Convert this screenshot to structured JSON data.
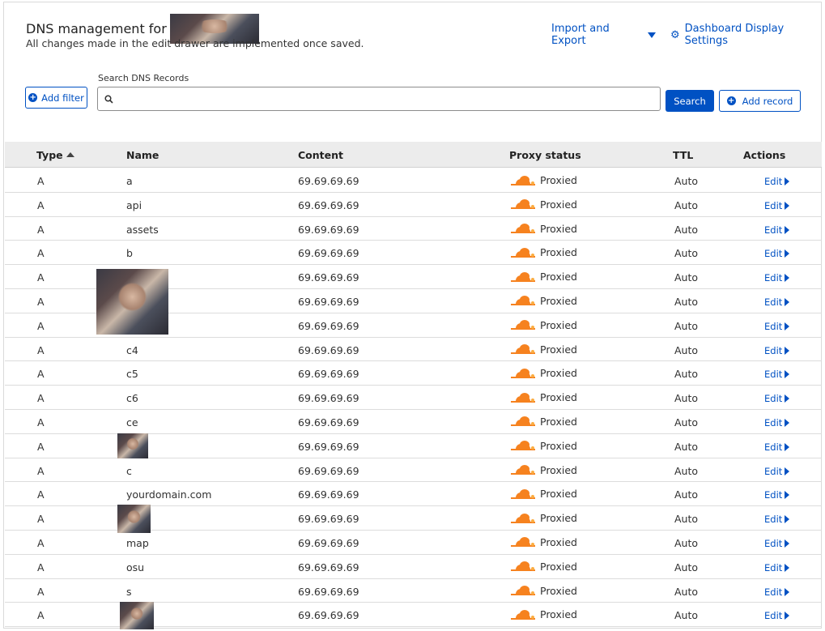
{
  "header": {
    "title": "DNS management for",
    "subtitle": "All changes made in the edit drawer are implemented once saved.",
    "import_export_label": "Import and Export",
    "display_settings_label": "Dashboard Display Settings"
  },
  "toolbar": {
    "add_filter_label": "Add filter",
    "search_label": "Search DNS Records",
    "search_value": "",
    "search_button_label": "Search",
    "add_record_label": "Add record"
  },
  "table": {
    "columns": [
      "Type",
      "Name",
      "Content",
      "Proxy status",
      "TTL",
      "Actions"
    ],
    "rows": [
      {
        "type": "A",
        "name": "a",
        "content": "69.69.69.69",
        "proxy": "Proxied",
        "ttl": "Auto",
        "action": "Edit"
      },
      {
        "type": "A",
        "name": "api",
        "content": "69.69.69.69",
        "proxy": "Proxied",
        "ttl": "Auto",
        "action": "Edit"
      },
      {
        "type": "A",
        "name": "assets",
        "content": "69.69.69.69",
        "proxy": "Proxied",
        "ttl": "Auto",
        "action": "Edit"
      },
      {
        "type": "A",
        "name": "b",
        "content": "69.69.69.69",
        "proxy": "Proxied",
        "ttl": "Auto",
        "action": "Edit"
      },
      {
        "type": "A",
        "name": "",
        "content": "69.69.69.69",
        "proxy": "Proxied",
        "ttl": "Auto",
        "action": "Edit"
      },
      {
        "type": "A",
        "name": "",
        "content": "69.69.69.69",
        "proxy": "Proxied",
        "ttl": "Auto",
        "action": "Edit"
      },
      {
        "type": "A",
        "name": "",
        "content": "69.69.69.69",
        "proxy": "Proxied",
        "ttl": "Auto",
        "action": "Edit"
      },
      {
        "type": "A",
        "name": "c4",
        "content": "69.69.69.69",
        "proxy": "Proxied",
        "ttl": "Auto",
        "action": "Edit"
      },
      {
        "type": "A",
        "name": "c5",
        "content": "69.69.69.69",
        "proxy": "Proxied",
        "ttl": "Auto",
        "action": "Edit"
      },
      {
        "type": "A",
        "name": "c6",
        "content": "69.69.69.69",
        "proxy": "Proxied",
        "ttl": "Auto",
        "action": "Edit"
      },
      {
        "type": "A",
        "name": "ce",
        "content": "69.69.69.69",
        "proxy": "Proxied",
        "ttl": "Auto",
        "action": "Edit"
      },
      {
        "type": "A",
        "name": "",
        "content": "69.69.69.69",
        "proxy": "Proxied",
        "ttl": "Auto",
        "action": "Edit"
      },
      {
        "type": "A",
        "name": "c",
        "content": "69.69.69.69",
        "proxy": "Proxied",
        "ttl": "Auto",
        "action": "Edit"
      },
      {
        "type": "A",
        "name": "yourdomain.com",
        "content": "69.69.69.69",
        "proxy": "Proxied",
        "ttl": "Auto",
        "action": "Edit"
      },
      {
        "type": "A",
        "name": "",
        "content": "69.69.69.69",
        "proxy": "Proxied",
        "ttl": "Auto",
        "action": "Edit"
      },
      {
        "type": "A",
        "name": "map",
        "content": "69.69.69.69",
        "proxy": "Proxied",
        "ttl": "Auto",
        "action": "Edit"
      },
      {
        "type": "A",
        "name": "osu",
        "content": "69.69.69.69",
        "proxy": "Proxied",
        "ttl": "Auto",
        "action": "Edit"
      },
      {
        "type": "A",
        "name": "s",
        "content": "69.69.69.69",
        "proxy": "Proxied",
        "ttl": "Auto",
        "action": "Edit"
      },
      {
        "type": "A",
        "name": "",
        "content": "69.69.69.69",
        "proxy": "Proxied",
        "ttl": "Auto",
        "action": "Edit"
      }
    ]
  },
  "icons": {
    "import_export_caret": "chevron-down-icon",
    "settings": "gear-icon",
    "search": "search-icon",
    "add": "plus-circle-icon",
    "sort": "sort-ascending-icon",
    "proxy": "cloudflare-cloud-icon",
    "edit_caret": "chevron-right-icon"
  },
  "colors": {
    "accent": "#0051c3",
    "proxy_orange": "#f6821f",
    "header_bg": "#ececec"
  }
}
